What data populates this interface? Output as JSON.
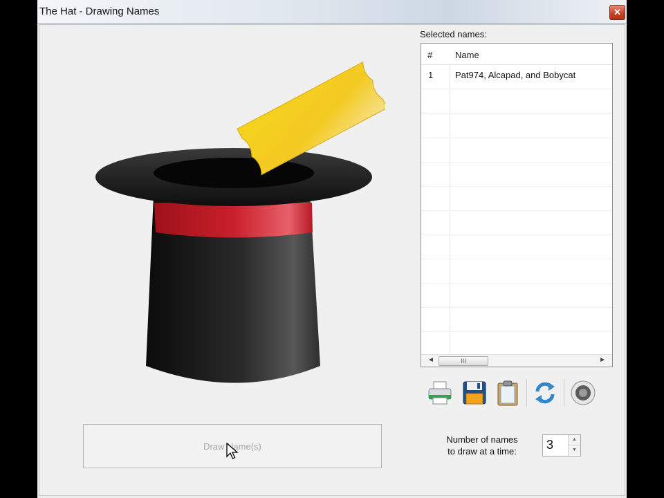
{
  "window": {
    "title": "The Hat - Drawing Names",
    "close_glyph": "✕"
  },
  "draw_button": {
    "label": "Draw Name(s)"
  },
  "selected": {
    "label": "Selected names:",
    "columns": {
      "num": "#",
      "name": "Name"
    },
    "rows": [
      {
        "num": "1",
        "name": "Pat974, Alcapad, and Bobycat"
      }
    ]
  },
  "scrollbar": {
    "left_arrow": "◄",
    "right_arrow": "►",
    "thumb_grip": "III"
  },
  "toolbar": {
    "icons": [
      "printer-icon",
      "save-disk-icon",
      "clipboard-icon",
      "refresh-icon",
      "speaker-icon"
    ]
  },
  "count": {
    "label_line1": "Number of names",
    "label_line2": "to draw at a time:",
    "value": "3",
    "up_glyph": "▲",
    "down_glyph": "▼"
  },
  "colors": {
    "hat_band": "#c8202a",
    "ticket": "#f0c419",
    "close_button": "#c7442a"
  }
}
